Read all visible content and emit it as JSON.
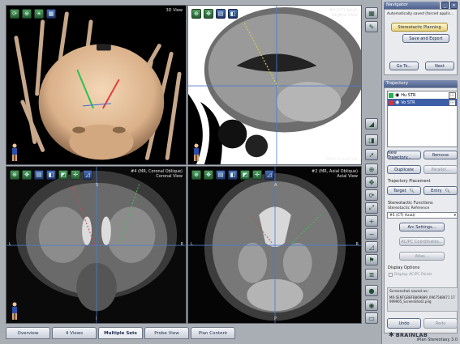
{
  "viewports": {
    "v3d": {
      "title": "3D View"
    },
    "sag": {
      "title_line1": "#5 (CT) Axial)",
      "title_line2": "Sagittal View",
      "footer": "Main Image Set"
    },
    "cor": {
      "title_line1": "#4 (MR, Coronal Oblique)",
      "title_line2": "Coronal View",
      "left": "L",
      "right": "R",
      "top": "S",
      "bottom": "I"
    },
    "ax": {
      "title_line1": "#2 (MR, Axial Oblique)",
      "title_line2": "Axial View",
      "left": "L",
      "right": "R",
      "top": "A",
      "bottom": "P"
    }
  },
  "navigator": {
    "title": "Navigator",
    "status": "Automatically saved (forced applic...",
    "step_label": "Stereotactic Planning",
    "save_export": "Save and Export",
    "goto": "Go To...",
    "next": "Next"
  },
  "trajectory": {
    "title": "Trajectory",
    "items": [
      {
        "name": "Hu STR",
        "color": "#27b24a"
      },
      {
        "name": "Vo STR",
        "color": "#d4343a"
      }
    ],
    "new_traj": "New Trajectory...",
    "remove": "Remove",
    "duplicate": "Duplicate",
    "parallel": "Parallel...",
    "placement_label": "Trajectory Placement",
    "target": "Target",
    "entry": "Entry",
    "functions_label": "Stereotactic Functions",
    "reference_label": "Stereotactic Reference",
    "reference_value": "#5 (CT) Axial)",
    "arc_settings": "Arc Settings...",
    "acpc": "AC/PC Coordinates...",
    "atlas": "Atlas...",
    "display_label": "Display Options",
    "display_acpc": "Display AC/PC Points",
    "saved_title": "Screenshot saved as:",
    "saved_path": "MR-5ENTGBBFB869889_0967588671 17999905_ScreenShot2.png",
    "undo": "Undo",
    "redo": "Redo"
  },
  "brand": {
    "name": "BRAINLAB",
    "product": "iPlan Stereotaxy 3.0"
  },
  "tabs": [
    "Overview",
    "4 Views",
    "Multiple Sets",
    "Probe View",
    "Plan Content"
  ],
  "active_tab": "Multiple Sets"
}
